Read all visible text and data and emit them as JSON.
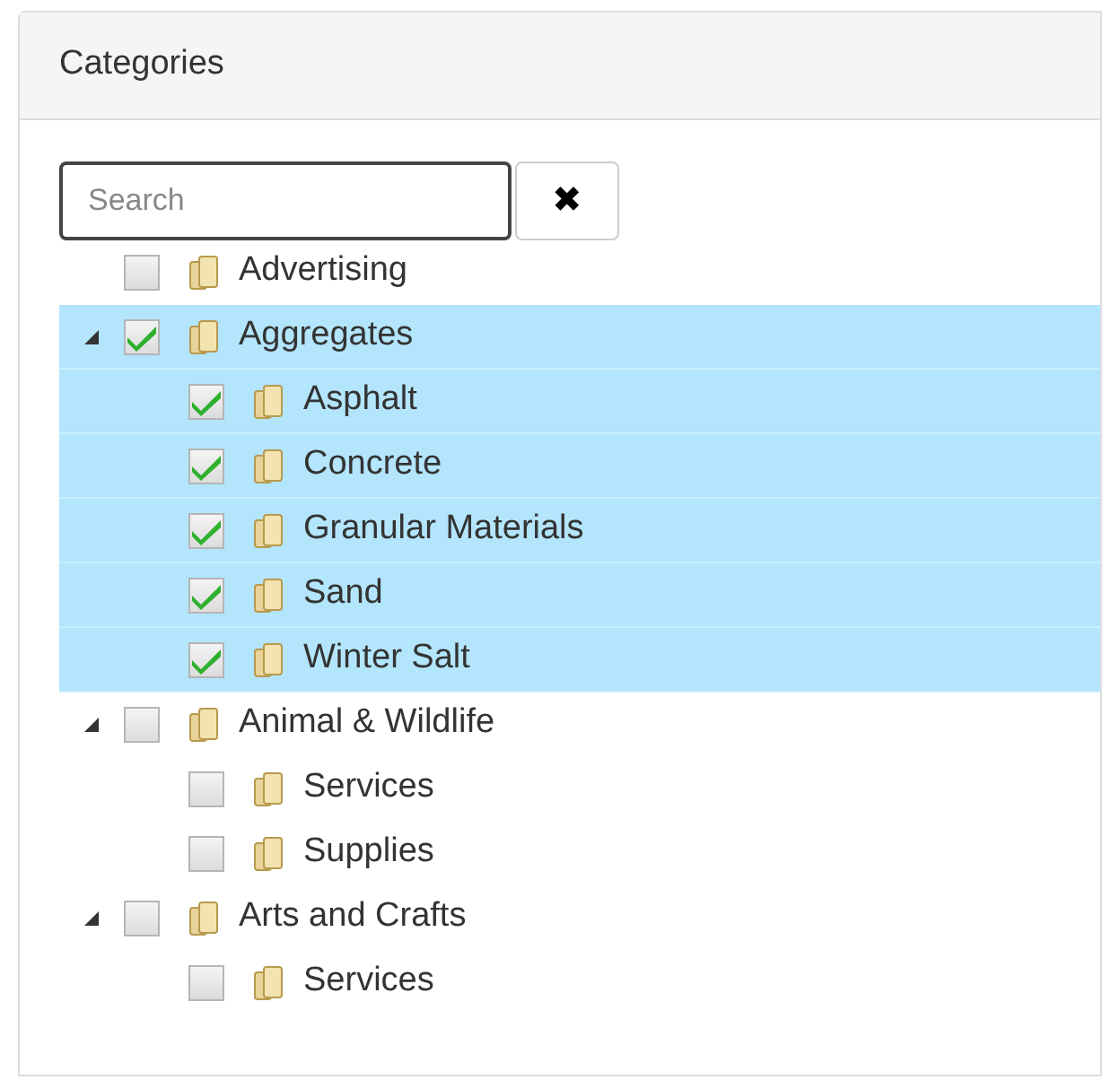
{
  "panel": {
    "title": "Categories"
  },
  "search": {
    "placeholder": "Search",
    "clear": "✖"
  },
  "tree": [
    {
      "label": "Advertising",
      "checked": false,
      "selected": false
    },
    {
      "label": "Aggregates",
      "checked": true,
      "selected": true,
      "expanded": true,
      "children": [
        {
          "label": "Asphalt",
          "checked": true,
          "selected": true
        },
        {
          "label": "Concrete",
          "checked": true,
          "selected": true
        },
        {
          "label": "Granular Materials",
          "checked": true,
          "selected": true
        },
        {
          "label": "Sand",
          "checked": true,
          "selected": true
        },
        {
          "label": "Winter Salt",
          "checked": true,
          "selected": true
        }
      ]
    },
    {
      "label": "Animal & Wildlife",
      "checked": false,
      "selected": false,
      "expanded": true,
      "children": [
        {
          "label": "Services",
          "checked": false,
          "selected": false
        },
        {
          "label": "Supplies",
          "checked": false,
          "selected": false
        }
      ]
    },
    {
      "label": "Arts and Crafts",
      "checked": false,
      "selected": false,
      "expanded": true,
      "children": [
        {
          "label": "Services",
          "checked": false,
          "selected": false
        }
      ]
    }
  ]
}
